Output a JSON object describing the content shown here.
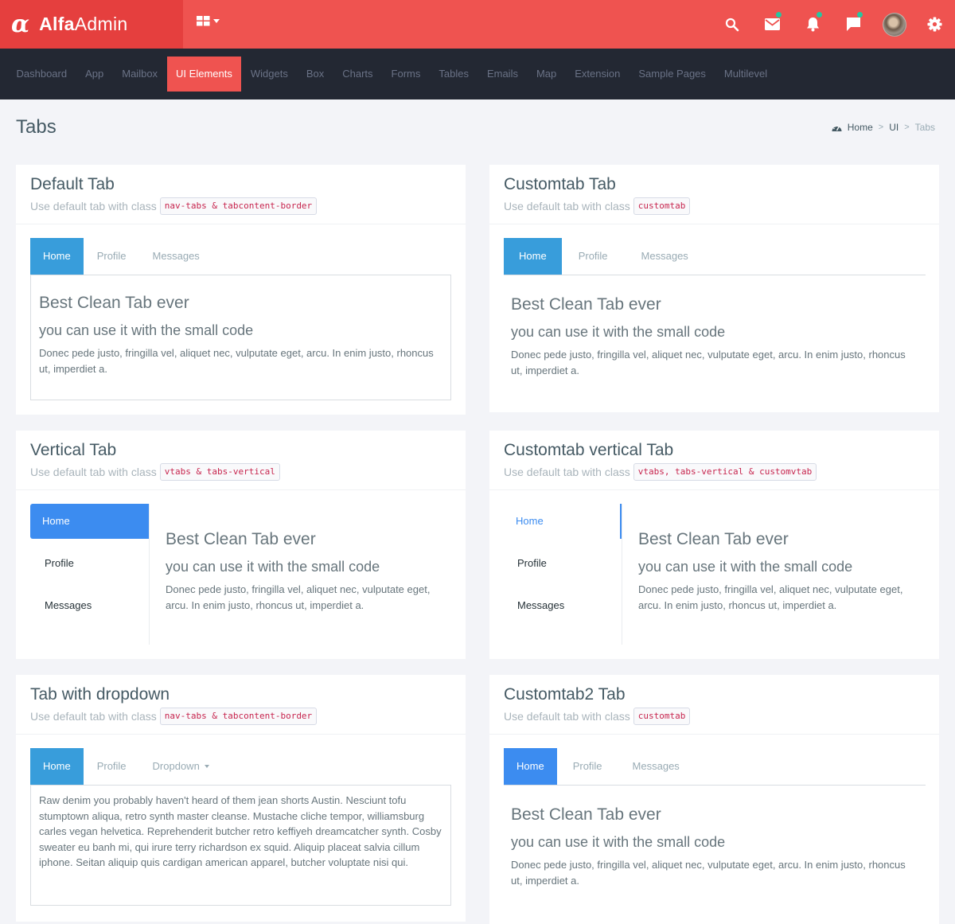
{
  "app": {
    "brand_bold": "Alfa",
    "brand_light": "Admin",
    "logo_glyph": "α"
  },
  "header": {
    "icons": [
      {
        "name": "search-icon",
        "badge": false
      },
      {
        "name": "mail-icon",
        "badge": true
      },
      {
        "name": "bell-icon",
        "badge": true
      },
      {
        "name": "chat-icon",
        "badge": true
      },
      {
        "name": "avatar",
        "badge": false
      },
      {
        "name": "gear-icon",
        "badge": false
      }
    ],
    "badge_color": "#26c6a0"
  },
  "nav": {
    "items": [
      "Dashboard",
      "App",
      "Mailbox",
      "UI Elements",
      "Widgets",
      "Box",
      "Charts",
      "Forms",
      "Tables",
      "Emails",
      "Map",
      "Extension",
      "Sample Pages",
      "Multilevel"
    ],
    "active": "UI Elements",
    "active_color": "#ef5350"
  },
  "page": {
    "title": "Tabs",
    "breadcrumb": [
      "Home",
      "UI",
      "Tabs"
    ]
  },
  "common": {
    "subtitle_prefix": "Use default tab with class",
    "heading": "Best Clean Tab ever",
    "subheading": "you can use it with the small code",
    "paragraph": "Donec pede justo, fringilla vel, aliquet nec, vulputate eget, arcu. In enim justo, rhoncus ut, imperdiet a."
  },
  "cards": {
    "default_tab": {
      "title": "Default Tab",
      "code": "nav-tabs & tabcontent-border",
      "tabs": [
        "Home",
        "Profile",
        "Messages"
      ],
      "active": "Home"
    },
    "custom_tab": {
      "title": "Customtab Tab",
      "code": "customtab",
      "tabs": [
        "Home",
        "Profile",
        "Messages"
      ],
      "active": "Home"
    },
    "vertical_tab": {
      "title": "Vertical Tab",
      "code": "vtabs & tabs-vertical",
      "tabs": [
        "Home",
        "Profile",
        "Messages"
      ],
      "active": "Home"
    },
    "custom_vertical_tab": {
      "title": "Customtab vertical Tab",
      "code": "vtabs, tabs-vertical & customvtab",
      "tabs": [
        "Home",
        "Profile",
        "Messages"
      ],
      "active": "Home"
    },
    "dropdown_tab": {
      "title": "Tab with dropdown",
      "code": "nav-tabs & tabcontent-border",
      "tabs": [
        "Home",
        "Profile",
        "Dropdown"
      ],
      "active": "Home",
      "content": "Raw denim you probably haven't heard of them jean shorts Austin. Nesciunt tofu stumptown aliqua, retro synth master cleanse. Mustache cliche tempor, williamsburg carles vegan helvetica. Reprehenderit butcher retro keffiyeh dreamcatcher synth. Cosby sweater eu banh mi, qui irure terry richardson ex squid. Aliquip placeat salvia cillum iphone. Seitan aliquip quis cardigan american apparel, butcher voluptate nisi qui."
    },
    "custom_tab2": {
      "title": "Customtab2 Tab",
      "code": "customtab",
      "tabs": [
        "Home",
        "Profile",
        "Messages"
      ],
      "active": "Home"
    }
  },
  "colors": {
    "header_red": "#ef5350",
    "brand_red": "#e53f3e",
    "nav_dark": "#232833",
    "tab_blue": "#389ddb",
    "tab_blue_alt": "#3c8cf0",
    "code_red": "#c7254e"
  }
}
